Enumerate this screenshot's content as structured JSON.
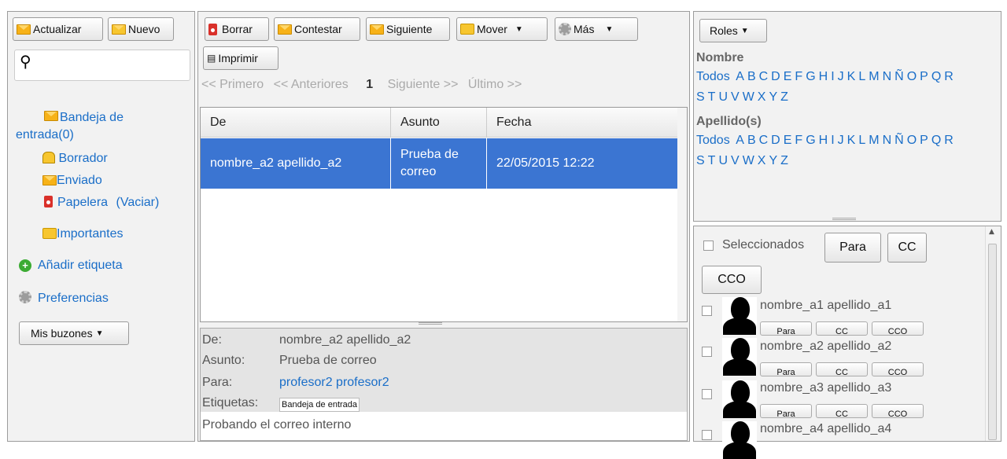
{
  "sidebar": {
    "refresh_label": "Actualizar",
    "new_label": "Nuevo",
    "search_placeholder": "",
    "folders": {
      "inbox": "Bandeja de entrada(0)",
      "drafts": "Borrador",
      "sent": "Enviado",
      "trash": "Papelera",
      "empty_trash": "(Vaciar)",
      "important": "Importantes"
    },
    "add_label": "Añadir etiqueta",
    "preferences": "Preferencias",
    "mailboxes_button": "Mis buzones"
  },
  "toolbar": {
    "delete": "Borrar",
    "reply": "Contestar",
    "next": "Siguiente",
    "move": "Mover",
    "more": "Más",
    "print": "Imprimir"
  },
  "pager": {
    "first": "<< Primero",
    "prev": "<< Anteriores",
    "page": "1",
    "next": "Siguiente >>",
    "last": "Último >>"
  },
  "message_list": {
    "columns": [
      "De",
      "Asunto",
      "Fecha"
    ],
    "rows": [
      {
        "from": "nombre_a2 apellido_a2",
        "subject_line1": "Prueba de",
        "subject_line2": "correo",
        "date": "22/05/2015 12:22"
      }
    ]
  },
  "detail": {
    "from_label": "De:",
    "from_value": "nombre_a2 apellido_a2",
    "subject_label": "Asunto:",
    "subject_value": "Prueba de correo",
    "to_label": "Para:",
    "to_value": "profesor2 profesor2",
    "tags_label": "Etiquetas:",
    "tag_value": "Bandeja de entrada",
    "body": "Probando el correo interno"
  },
  "roles": {
    "button": "Roles",
    "name_heading": "Nombre",
    "surname_heading": "Apellido(s)",
    "all": "Todos",
    "letters_row1": [
      "A",
      "B",
      "C",
      "D",
      "E",
      "F",
      "G",
      "H",
      "I",
      "J",
      "K",
      "L",
      "M",
      "N",
      "Ñ",
      "O",
      "P",
      "Q",
      "R"
    ],
    "letters_row2": [
      "S",
      "T",
      "U",
      "V",
      "W",
      "X",
      "Y",
      "Z"
    ]
  },
  "recipients": {
    "selected_label": "Seleccionados",
    "to_btn": "Para",
    "cc_btn": "CC",
    "bcc_btn": "CCO",
    "small_to": "Para",
    "small_cc": "CC",
    "small_bcc": "CCO",
    "users": [
      "nombre_a1 apellido_a1",
      "nombre_a2 apellido_a2",
      "nombre_a3 apellido_a3",
      "nombre_a4 apellido_a4"
    ]
  },
  "colors": {
    "selection": "#3b75d2",
    "link": "#1a6ec8",
    "panel": "#f2f2f2"
  }
}
